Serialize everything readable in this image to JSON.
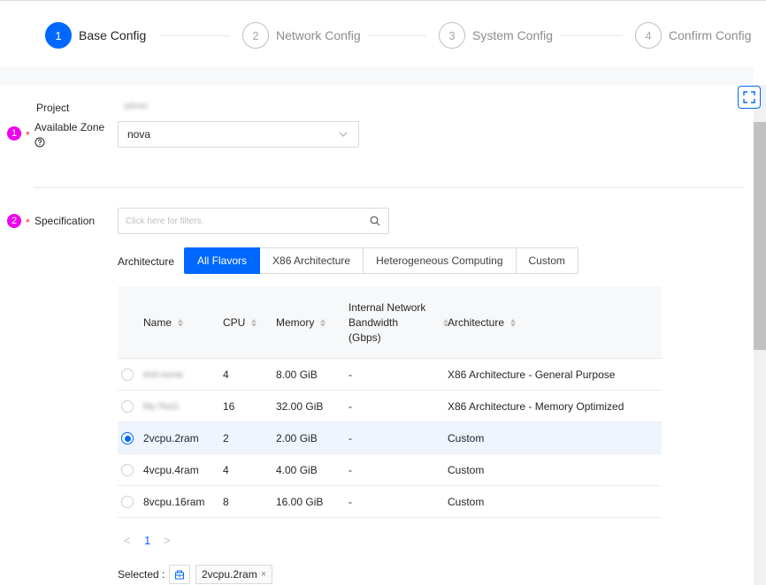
{
  "steps": [
    {
      "num": "1",
      "label": "Base Config"
    },
    {
      "num": "2",
      "label": "Network Config"
    },
    {
      "num": "3",
      "label": "System Config"
    },
    {
      "num": "4",
      "label": "Confirm Config"
    }
  ],
  "form": {
    "project_label": "Project",
    "project_value": "admin",
    "zone_marker": "1",
    "zone_required": "*",
    "zone_label": "Available Zone",
    "zone_value": "nova",
    "spec_marker": "2",
    "spec_required": "*",
    "spec_label": "Specification",
    "search_placeholder": "Click here for filters.",
    "arch_label": "Architecture"
  },
  "arch_tabs": [
    "All Flavors",
    "X86 Architecture",
    "Heterogeneous Computing",
    "Custom"
  ],
  "table": {
    "columns": {
      "name": "Name",
      "cpu": "CPU",
      "memory": "Memory",
      "bandwidth_1": "Internal Network",
      "bandwidth_2": "Bandwidth",
      "bandwidth_3": "(Gbps)",
      "architecture": "Architecture"
    },
    "rows": [
      {
        "name": "test-numa",
        "cpu": "4",
        "memory": "8.00 GiB",
        "bandwidth": "-",
        "architecture": "X86 Architecture - General Purpose"
      },
      {
        "name": "My-Test1",
        "cpu": "16",
        "memory": "32.00 GiB",
        "bandwidth": "-",
        "architecture": "X86 Architecture - Memory Optimized"
      },
      {
        "name": "2vcpu.2ram",
        "cpu": "2",
        "memory": "2.00 GiB",
        "bandwidth": "-",
        "architecture": "Custom"
      },
      {
        "name": "4vcpu.4ram",
        "cpu": "4",
        "memory": "4.00 GiB",
        "bandwidth": "-",
        "architecture": "Custom"
      },
      {
        "name": "8vcpu.16ram",
        "cpu": "8",
        "memory": "16.00 GiB",
        "bandwidth": "-",
        "architecture": "Custom"
      }
    ],
    "selected_index": 2
  },
  "pagination": {
    "prev": "<",
    "page": "1",
    "next": ">"
  },
  "selected": {
    "label": "Selected :",
    "tag": "2vcpu.2ram",
    "remove": "×"
  },
  "colors": {
    "accent": "#0068ff",
    "marker": "#ee00ee",
    "required": "#f5222d"
  },
  "icons": [
    "fullscreen-icon",
    "help-circle-icon",
    "chevron-down-icon",
    "search-icon",
    "flavor-icon",
    "close-icon",
    "sort-icon"
  ]
}
